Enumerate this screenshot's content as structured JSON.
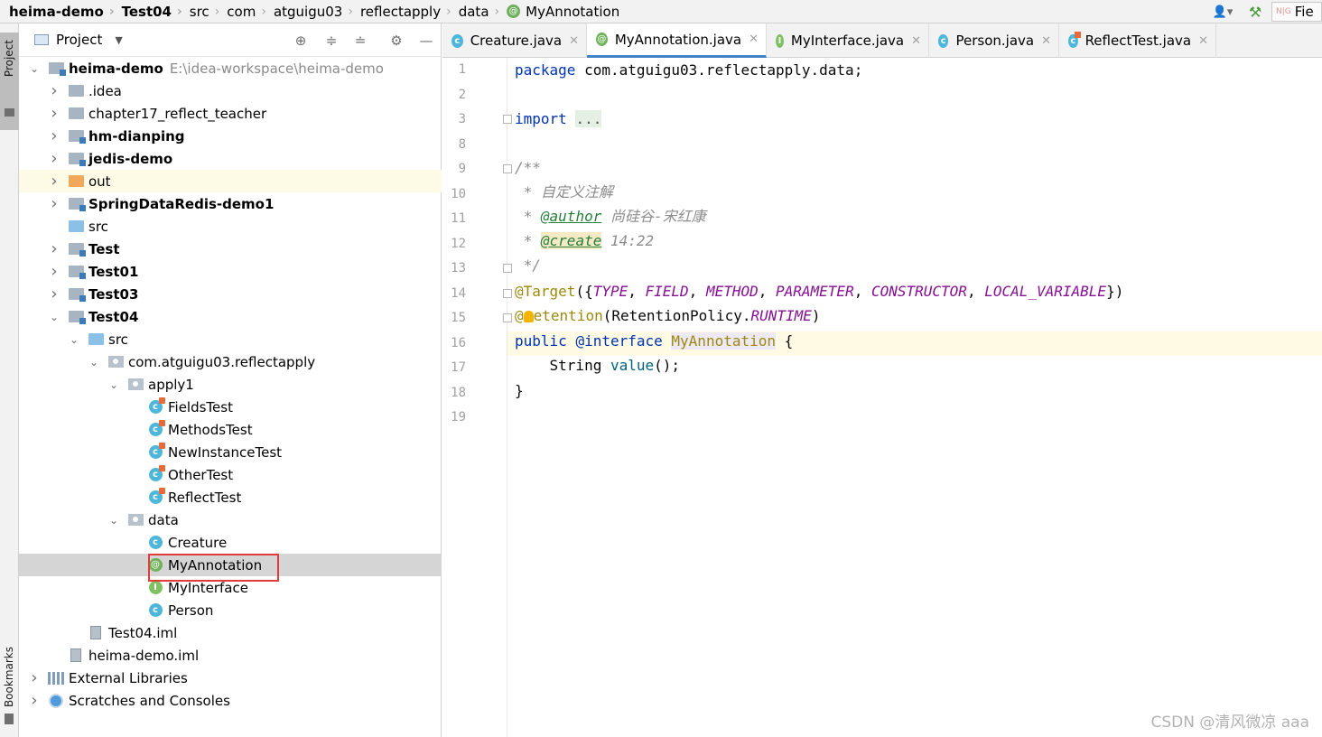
{
  "breadcrumb": [
    {
      "label": "heima-demo",
      "bold": true
    },
    {
      "label": "Test04",
      "bold": true
    },
    {
      "label": "src",
      "bold": false
    },
    {
      "label": "com",
      "bold": false
    },
    {
      "label": "atguigu03",
      "bold": false
    },
    {
      "label": "reflectapply",
      "bold": false
    },
    {
      "label": "data",
      "bold": false
    },
    {
      "label": "MyAnnotation",
      "bold": false
    }
  ],
  "toolbar_right": {
    "field_text": "Fie",
    "ng_text": "N|G",
    "user_icon": "user-icon",
    "build_icon": "hammer-icon"
  },
  "tool_strip": {
    "project_tab": "Project",
    "bookmarks_tab": "Bookmarks"
  },
  "project_panel": {
    "title": "Project",
    "tree": [
      {
        "label": "heima-demo",
        "path": "E:\\idea-workspace\\heima-demo",
        "bold": true,
        "icon": "module-folder",
        "arrow": "open",
        "depth": 0
      },
      {
        "label": ".idea",
        "bold": false,
        "icon": "folder",
        "arrow": "closed",
        "depth": 1
      },
      {
        "label": "chapter17_reflect_teacher",
        "bold": false,
        "icon": "folder",
        "arrow": "closed",
        "depth": 1
      },
      {
        "label": "hm-dianping",
        "bold": true,
        "icon": "module-folder",
        "arrow": "closed",
        "depth": 1
      },
      {
        "label": "jedis-demo",
        "bold": true,
        "icon": "module-folder",
        "arrow": "closed",
        "depth": 1
      },
      {
        "label": "out",
        "bold": false,
        "icon": "out-folder",
        "arrow": "closed",
        "depth": 1
      },
      {
        "label": "SpringDataRedis-demo1",
        "bold": true,
        "icon": "module-folder",
        "arrow": "closed",
        "depth": 1
      },
      {
        "label": "src",
        "bold": false,
        "icon": "src-folder",
        "arrow": "none",
        "depth": 1
      },
      {
        "label": "Test",
        "bold": true,
        "icon": "module-folder",
        "arrow": "closed",
        "depth": 1
      },
      {
        "label": "Test01",
        "bold": true,
        "icon": "module-folder",
        "arrow": "closed",
        "depth": 1
      },
      {
        "label": "Test03",
        "bold": true,
        "icon": "module-folder",
        "arrow": "closed",
        "depth": 1
      },
      {
        "label": "Test04",
        "bold": true,
        "icon": "module-folder",
        "arrow": "open",
        "depth": 1
      },
      {
        "label": "src",
        "bold": false,
        "icon": "src-folder",
        "arrow": "open",
        "depth": 2
      },
      {
        "label": "com.atguigu03.reflectapply",
        "bold": false,
        "icon": "package",
        "arrow": "open",
        "depth": 3
      },
      {
        "label": "apply1",
        "bold": false,
        "icon": "package",
        "arrow": "open",
        "depth": 4
      },
      {
        "label": "FieldsTest",
        "bold": false,
        "icon": "class-run",
        "arrow": "none",
        "depth": 5
      },
      {
        "label": "MethodsTest",
        "bold": false,
        "icon": "class-run",
        "arrow": "none",
        "depth": 5
      },
      {
        "label": "NewInstanceTest",
        "bold": false,
        "icon": "class-run",
        "arrow": "none",
        "depth": 5
      },
      {
        "label": "OtherTest",
        "bold": false,
        "icon": "class-run",
        "arrow": "none",
        "depth": 5
      },
      {
        "label": "ReflectTest",
        "bold": false,
        "icon": "class-run",
        "arrow": "none",
        "depth": 5
      },
      {
        "label": "data",
        "bold": false,
        "icon": "package",
        "arrow": "open",
        "depth": 4
      },
      {
        "label": "Creature",
        "bold": false,
        "icon": "class",
        "arrow": "none",
        "depth": 5
      },
      {
        "label": "MyAnnotation",
        "bold": false,
        "icon": "annotation",
        "arrow": "none",
        "depth": 5
      },
      {
        "label": "MyInterface",
        "bold": false,
        "icon": "interface",
        "arrow": "none",
        "depth": 5
      },
      {
        "label": "Person",
        "bold": false,
        "icon": "class",
        "arrow": "none",
        "depth": 5
      },
      {
        "label": "Test04.iml",
        "bold": false,
        "icon": "iml",
        "arrow": "none",
        "depth": 2
      },
      {
        "label": "heima-demo.iml",
        "bold": false,
        "icon": "iml",
        "arrow": "none",
        "depth": 1
      },
      {
        "label": "External Libraries",
        "bold": false,
        "icon": "libraries",
        "arrow": "closed",
        "depth": 0
      },
      {
        "label": "Scratches and Consoles",
        "bold": false,
        "icon": "scratches",
        "arrow": "closed",
        "depth": 0
      }
    ]
  },
  "editor": {
    "tabs": [
      {
        "label": "Creature.java",
        "icon": "c",
        "active": false
      },
      {
        "label": "MyAnnotation.java",
        "icon": "@",
        "active": true
      },
      {
        "label": "MyInterface.java",
        "icon": "I",
        "active": false
      },
      {
        "label": "Person.java",
        "icon": "c",
        "active": false
      },
      {
        "label": "ReflectTest.java",
        "icon": "c",
        "active": false
      }
    ],
    "line_numbers": [
      "1",
      "2",
      "3",
      "8",
      "9",
      "10",
      "11",
      "12",
      "13",
      "14",
      "15",
      "16",
      "17",
      "18",
      "19"
    ],
    "code": {
      "l1_kw": "package",
      "l1_rest": " com.atguigu03.reflectapply.data;",
      "l3_kw": "import",
      "l3_fold": "...",
      "l9": "/**",
      "l10": " * 自定义注解",
      "l11_pre": " * ",
      "l11_tag": "@author",
      "l11_val": " 尚硅谷-宋红康",
      "l12_pre": " * ",
      "l12_tag": "@create",
      "l12_val": " 14:22",
      "l13": " */",
      "l14_ann": "@Target",
      "l14_open": "({",
      "l14_c1": "TYPE",
      "l14_c2": "FIELD",
      "l14_c3": "METHOD",
      "l14_c4": "PARAMETER",
      "l14_c5": "CONSTRUCTOR",
      "l14_c6": "LOCAL_VARIABLE",
      "l14_sep": ", ",
      "l14_close": "})",
      "l15_at": "@",
      "l15_ann": "etention",
      "l15_arg": "(RetentionPolicy.",
      "l15_const": "RUNTIME",
      "l15_close": ")",
      "l16_kw1": "public",
      "l16_kw2": "@interface",
      "l16_name": "MyAnnotation",
      "l16_brace": " {",
      "l17_type": "    String ",
      "l17_meth": "value",
      "l17_rest": "();",
      "l18": "}"
    }
  },
  "watermark": "CSDN @清风微凉 aaa"
}
